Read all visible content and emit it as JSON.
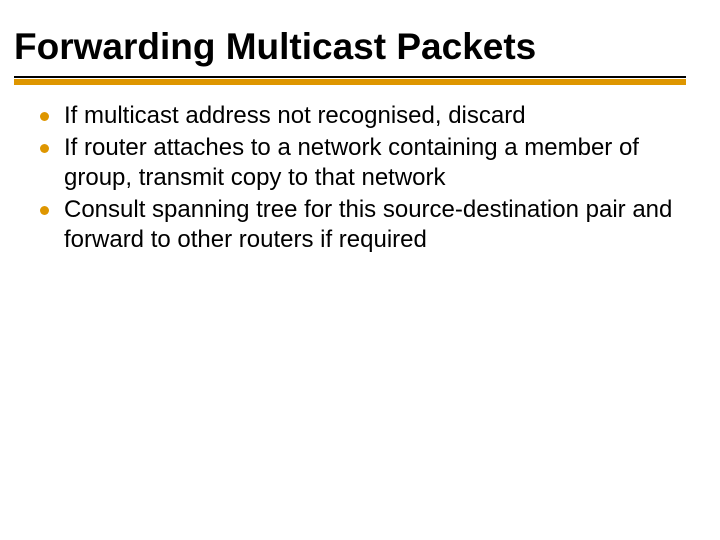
{
  "colors": {
    "accent": "#de9600",
    "text": "#000000",
    "background": "#ffffff"
  },
  "slide": {
    "title": "Forwarding Multicast Packets",
    "bullets": [
      "If multicast address not recognised, discard",
      "If router attaches to a network containing a member of group, transmit copy to that network",
      "Consult spanning tree for this source-destination pair and forward to other routers if required"
    ]
  }
}
